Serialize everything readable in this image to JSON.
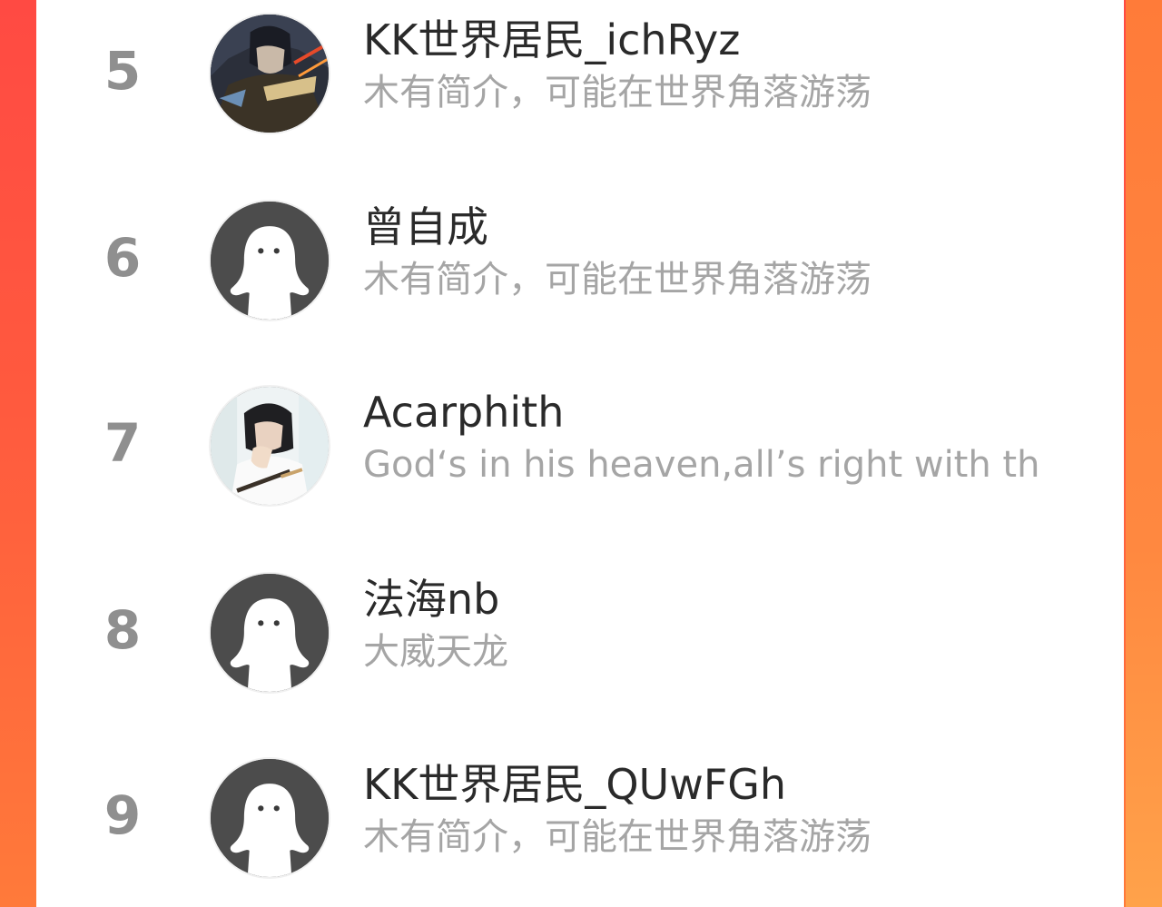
{
  "leaderboard": {
    "items": [
      {
        "rank": "5",
        "name": "KK世界居民_ichRyz",
        "bio": "木有简介，可能在世界角落游荡",
        "avatar": "anime-character-photo"
      },
      {
        "rank": "6",
        "name": "曾自成",
        "bio": "木有简介，可能在世界角落游荡",
        "avatar": "default-ghost-avatar"
      },
      {
        "rank": "7",
        "name": "Acarphith",
        "bio": "God‘s in his heaven,all’s right with th",
        "avatar": "person-photo"
      },
      {
        "rank": "8",
        "name": "法海nb",
        "bio": "大威天龙",
        "avatar": "default-ghost-avatar"
      },
      {
        "rank": "9",
        "name": "KK世界居民_QUwFGh",
        "bio": "木有简介，可能在世界角落游荡",
        "avatar": "default-ghost-avatar"
      }
    ]
  },
  "colors": {
    "background_top": "#ff4a43",
    "background_bottom": "#ff7a3a",
    "rank_gray": "#8f8f8f",
    "name_dark": "#2a2a2a",
    "bio_gray": "#a5a5a5",
    "default_avatar_bg": "#4c4c4c"
  }
}
